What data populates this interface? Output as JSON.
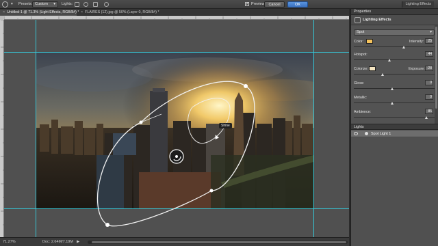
{
  "options_bar": {
    "presets_label": "Presets:",
    "presets_value": "Custom",
    "lights_label": "Lights:",
    "preview_label": "Preview",
    "preview_checked": true,
    "cancel_label": "Cancel",
    "ok_label": "OK",
    "workspace_label": "Lighting Effects"
  },
  "tabs": [
    {
      "label": "Untitled-1 @ 71.3% (Light Effects, RGB/8#) *",
      "active": true
    },
    {
      "label": "FLAIRES (12).jpg @ 50% (Layer 0, RGB/8#) *",
      "active": false
    }
  ],
  "canvas": {
    "spot_label": "Shine"
  },
  "status": {
    "zoom": "71.27%",
    "doc": "Doc: 2.64M/7.19M"
  },
  "properties": {
    "tab_label": "Properties",
    "header": "Lighting Effects",
    "light_type": "Spot",
    "color_label": "Color:",
    "color_value": "#f5c35c",
    "intensity_label": "Intensity:",
    "intensity_value": "25",
    "hotspot_label": "Hotspot:",
    "hotspot_value": "44",
    "colorize_label": "Colorize:",
    "colorize_value": "#f4e4c0",
    "exposure_label": "Exposure:",
    "exposure_value": "-28",
    "gloss_label": "Gloss:",
    "gloss_value": "0",
    "metallic_label": "Metallic:",
    "metallic_value": "0",
    "ambience_label": "Ambience:",
    "ambience_value": "85"
  },
  "lights_panel": {
    "tab_label": "Lights",
    "items": [
      {
        "name": "Spot Light 1"
      }
    ]
  },
  "colors": {
    "guide": "#37c6d6",
    "accent": "#3a71c1"
  }
}
